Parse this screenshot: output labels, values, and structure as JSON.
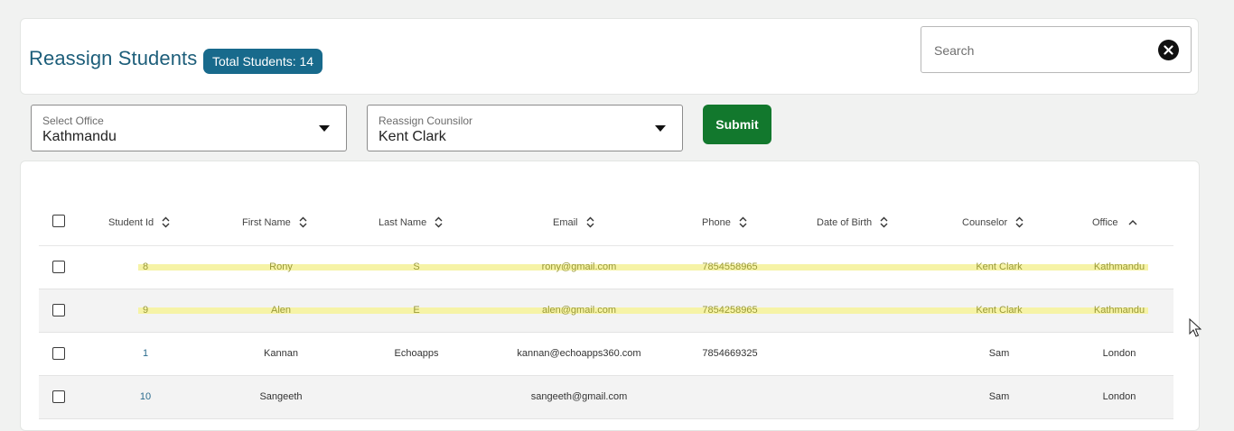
{
  "header": {
    "title": "Reassign Students",
    "total_badge": "Total Students: 14",
    "search": {
      "placeholder": "Search",
      "value": ""
    }
  },
  "filters": {
    "office": {
      "label": "Select Office",
      "value": "Kathmandu"
    },
    "counselor": {
      "label": "Reassign Counsilor",
      "value": "Kent Clark"
    },
    "submit_label": "Submit"
  },
  "table": {
    "columns": [
      "Student Id",
      "First Name",
      "Last Name",
      "Email",
      "Phone",
      "Date of Birth",
      "Counselor",
      "Office"
    ],
    "sort": {
      "column": "Office",
      "direction": "asc"
    },
    "rows": [
      {
        "id": "8",
        "first": "Rony",
        "last": "S",
        "email": "rony@gmail.com",
        "phone": "7854558965",
        "dob": "",
        "counselor": "Kent Clark",
        "office": "Kathmandu",
        "highlighted": true
      },
      {
        "id": "9",
        "first": "Alen",
        "last": "E",
        "email": "alen@gmail.com",
        "phone": "7854258965",
        "dob": "",
        "counselor": "Kent Clark",
        "office": "Kathmandu",
        "highlighted": true
      },
      {
        "id": "1",
        "first": "Kannan",
        "last": "Echoapps",
        "email": "kannan@echoapps360.com",
        "phone": "7854669325",
        "dob": "",
        "counselor": "Sam",
        "office": "London",
        "highlighted": false
      },
      {
        "id": "10",
        "first": "Sangeeth",
        "last": "",
        "email": "sangeeth@gmail.com",
        "phone": "",
        "dob": "",
        "counselor": "Sam",
        "office": "London",
        "highlighted": false
      }
    ]
  },
  "colors": {
    "brand": "#1d5e7a",
    "badge": "#186a8c",
    "submit": "#12782d",
    "highlight": "#f6f3a6"
  }
}
